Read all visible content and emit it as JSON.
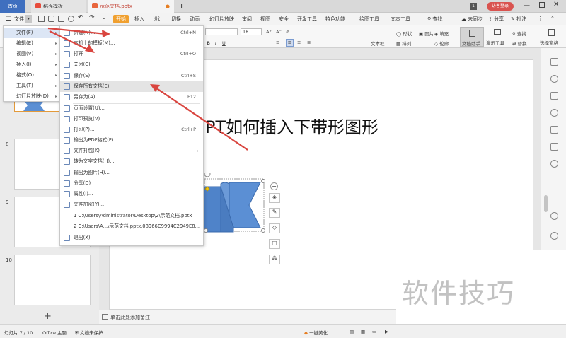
{
  "titlebar": {
    "home_tab": "首页",
    "template_tab": "稻壳模板",
    "doc_tab": "示范文档.pptx",
    "new_tab": "+",
    "login_btn": "访客登录",
    "page_badge": "1"
  },
  "menubar": {
    "file_label": "文件",
    "tabs": [
      "开始",
      "插入",
      "设计",
      "切换",
      "动画",
      "幻灯片放映",
      "审阅",
      "视图",
      "安全",
      "开发工具",
      "特色功能",
      "绘图工具",
      "文本工具"
    ],
    "search": "查找",
    "sync": "未同步",
    "share": "分享",
    "comment": "批注"
  },
  "ribbon": {
    "font_size": "18",
    "text_box": "文本框",
    "shape": "形状",
    "arrange": "排列",
    "picture": "图片",
    "fill": "填充",
    "outline": "轮廓",
    "doc_helper": "文档助手",
    "presenter": "演示工具",
    "find": "查找",
    "replace": "替换",
    "select_pane": "选择窗格"
  },
  "menu_level1": {
    "items": [
      {
        "label": "文件(F)",
        "arrow": "▸"
      },
      {
        "label": "编辑(E)",
        "arrow": "▸"
      },
      {
        "label": "视图(V)",
        "arrow": "▸"
      },
      {
        "label": "插入(I)",
        "arrow": "▸"
      },
      {
        "label": "格式(O)",
        "arrow": "▸"
      },
      {
        "label": "工具(T)",
        "arrow": "▸"
      },
      {
        "label": "幻灯片放映(D)",
        "arrow": "▸"
      }
    ]
  },
  "menu_file": {
    "items": [
      {
        "label": "新建(N)...",
        "shortcut": "Ctrl+N"
      },
      {
        "label": "本机上的模板(M)...",
        "shortcut": ""
      },
      {
        "label": "打开",
        "shortcut": "Ctrl+O"
      },
      {
        "label": "关闭(C)",
        "shortcut": ""
      },
      {
        "label": "保存(S)",
        "shortcut": "Ctrl+S"
      },
      {
        "label": "保存所有文档(E)",
        "shortcut": ""
      },
      {
        "label": "另存为(A)...",
        "shortcut": "F12"
      },
      {
        "label": "页面设置(U)...",
        "shortcut": ""
      },
      {
        "label": "打印预览(V)",
        "shortcut": ""
      },
      {
        "label": "打印(P)...",
        "shortcut": "Ctrl+P"
      },
      {
        "label": "输出为PDF格式(F)...",
        "shortcut": ""
      },
      {
        "label": "文件打包(K)",
        "shortcut": "▸"
      },
      {
        "label": "转为文字文档(H)...",
        "shortcut": ""
      },
      {
        "label": "输出为图片(H)...",
        "shortcut": ""
      },
      {
        "label": "分享(D)",
        "shortcut": ""
      },
      {
        "label": "属性(I)...",
        "shortcut": ""
      },
      {
        "label": "文件加密(Y)...",
        "shortcut": ""
      },
      {
        "label": "1 C:\\Users\\Administrator\\Desktop\\2\\示范文档.pptx",
        "shortcut": ""
      },
      {
        "label": "2 C:\\Users\\A...\\示范文档.pptx.08966C9994C2949E8...",
        "shortcut": ""
      },
      {
        "label": "退出(X)",
        "shortcut": ""
      }
    ]
  },
  "slides_panel": {
    "numbers": [
      "8",
      "9",
      "10"
    ],
    "add": "+"
  },
  "slide": {
    "title": "PT如何插入下带形图形"
  },
  "notes": {
    "placeholder": "单击此处添加备注"
  },
  "status": {
    "slide_info": "幻灯片 7 / 10",
    "theme": "Office 主题",
    "protect": "文档未保护",
    "beautify": "一键美化"
  },
  "watermark": {
    "text": "软件技巧"
  },
  "colors": {
    "accent": "#3f6fbf",
    "start_tab": "#f0a030",
    "shape_fill": "#5b8fd4",
    "arrow_red": "#d9453f",
    "login_red": "#d9534f"
  }
}
